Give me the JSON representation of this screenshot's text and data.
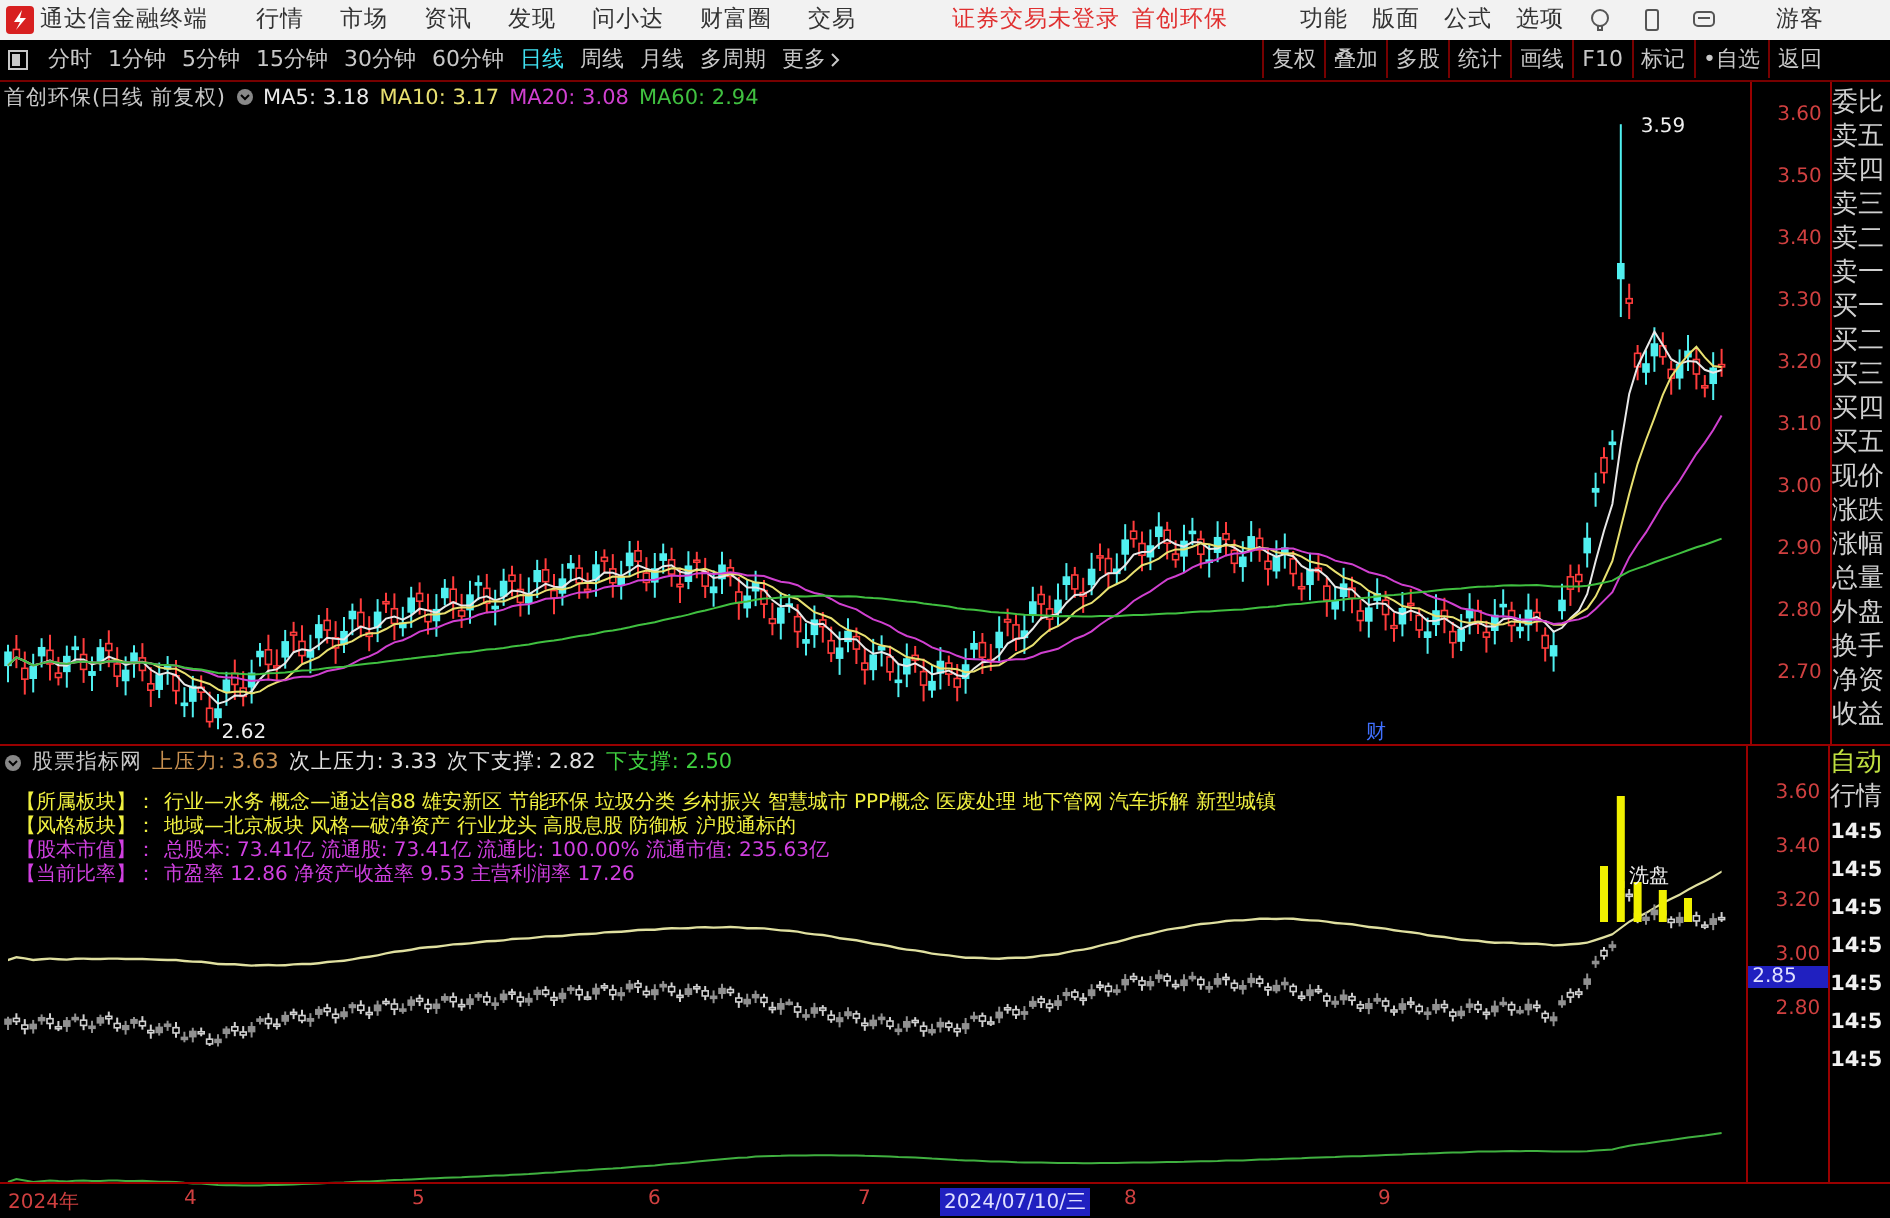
{
  "menu_bar": {
    "app_title": "通达信金融终端",
    "menus": [
      "行情",
      "市场",
      "资讯",
      "发现",
      "问小达",
      "财富圈",
      "交易"
    ],
    "notice": "证券交易未登录",
    "stock": "首创环保",
    "tools": [
      "功能",
      "版面",
      "公式",
      "选项"
    ],
    "user": "游客"
  },
  "period_tabs": [
    {
      "label": "分时",
      "selected": false
    },
    {
      "label": "1分钟",
      "selected": false
    },
    {
      "label": "5分钟",
      "selected": false
    },
    {
      "label": "15分钟",
      "selected": false
    },
    {
      "label": "30分钟",
      "selected": false
    },
    {
      "label": "60分钟",
      "selected": false
    },
    {
      "label": "日线",
      "selected": true
    },
    {
      "label": "周线",
      "selected": false
    },
    {
      "label": "月线",
      "selected": false
    },
    {
      "label": "多周期",
      "selected": false
    },
    {
      "label": "更多",
      "selected": false
    }
  ],
  "toolbar": [
    "复权",
    "叠加",
    "多股",
    "统计",
    "画线",
    "F10",
    "标记",
    "•自选",
    "返回"
  ],
  "chart_header": {
    "title": "首创环保(日线 前复权)",
    "ma": [
      {
        "label": "MA5: 3.18",
        "color": "#e8e8e8"
      },
      {
        "label": "MA10: 3.17",
        "color": "#e8e070"
      },
      {
        "label": "MA20: 3.08",
        "color": "#d040d0"
      },
      {
        "label": "MA60: 2.94",
        "color": "#40c040"
      }
    ]
  },
  "price_axis": [
    "3.60",
    "3.50",
    "3.40",
    "3.30",
    "3.20",
    "3.10",
    "3.00",
    "2.90",
    "2.80",
    "2.70"
  ],
  "high_label": "3.59",
  "low_label": "2.62",
  "event_label": "财",
  "quote_labels": [
    "委比",
    "卖五",
    "卖四",
    "卖三",
    "卖二",
    "卖一",
    "买一",
    "买二",
    "买三",
    "买四",
    "买五",
    "现价",
    "涨跌",
    "涨幅",
    "总量",
    "外盘",
    "换手",
    "净资",
    "收益"
  ],
  "indicator": {
    "title": "股票指标网",
    "levels": [
      {
        "label": "上压力:",
        "value": "3.63",
        "color": "#c89050"
      },
      {
        "label": "次上压力:",
        "value": "3.33",
        "color": "#e0e0e0"
      },
      {
        "label": "次下支撑:",
        "value": "2.82",
        "color": "#e0e0e0"
      },
      {
        "label": "下支撑:",
        "value": "2.50",
        "color": "#40d040"
      }
    ],
    "info": [
      {
        "label": "【所属板块】：",
        "text": "行业—水务 概念—通达信88 雄安新区 节能环保 垃圾分类 乡村振兴 智慧城市 PPP概念 医废处理 地下管网 汽车拆解 新型城镇",
        "color": "#f0f040"
      },
      {
        "label": "【风格板块】：",
        "text": "地域—北京板块 风格—破净资产 行业龙头 高股息股 防御板 沪股通标的",
        "color": "#f0f040"
      },
      {
        "label": "【股本市值】：",
        "text": "总股本: 73.41亿 流通股: 73.41亿 流通比: 100.00% 流通市值: 235.63亿",
        "color": "#d040e0"
      },
      {
        "label": "【当前比率】：",
        "text": "市盈率 12.86 净资产收益率 9.53 主营利润率 17.26",
        "color": "#d040e0"
      }
    ],
    "mark": "洗盘",
    "axis": [
      "3.60",
      "3.40",
      "3.20",
      "3.00",
      "2.80"
    ],
    "current": "2.85"
  },
  "side_labels": [
    "自动",
    "行情"
  ],
  "times": [
    "14:5",
    "14:5",
    "14:5",
    "14:5",
    "14:5",
    "14:5",
    "14:5"
  ],
  "date_axis": {
    "labels": [
      "2024年",
      "4",
      "5",
      "6",
      "7",
      "8",
      "9"
    ],
    "current": "2024/07/10/三"
  }
}
